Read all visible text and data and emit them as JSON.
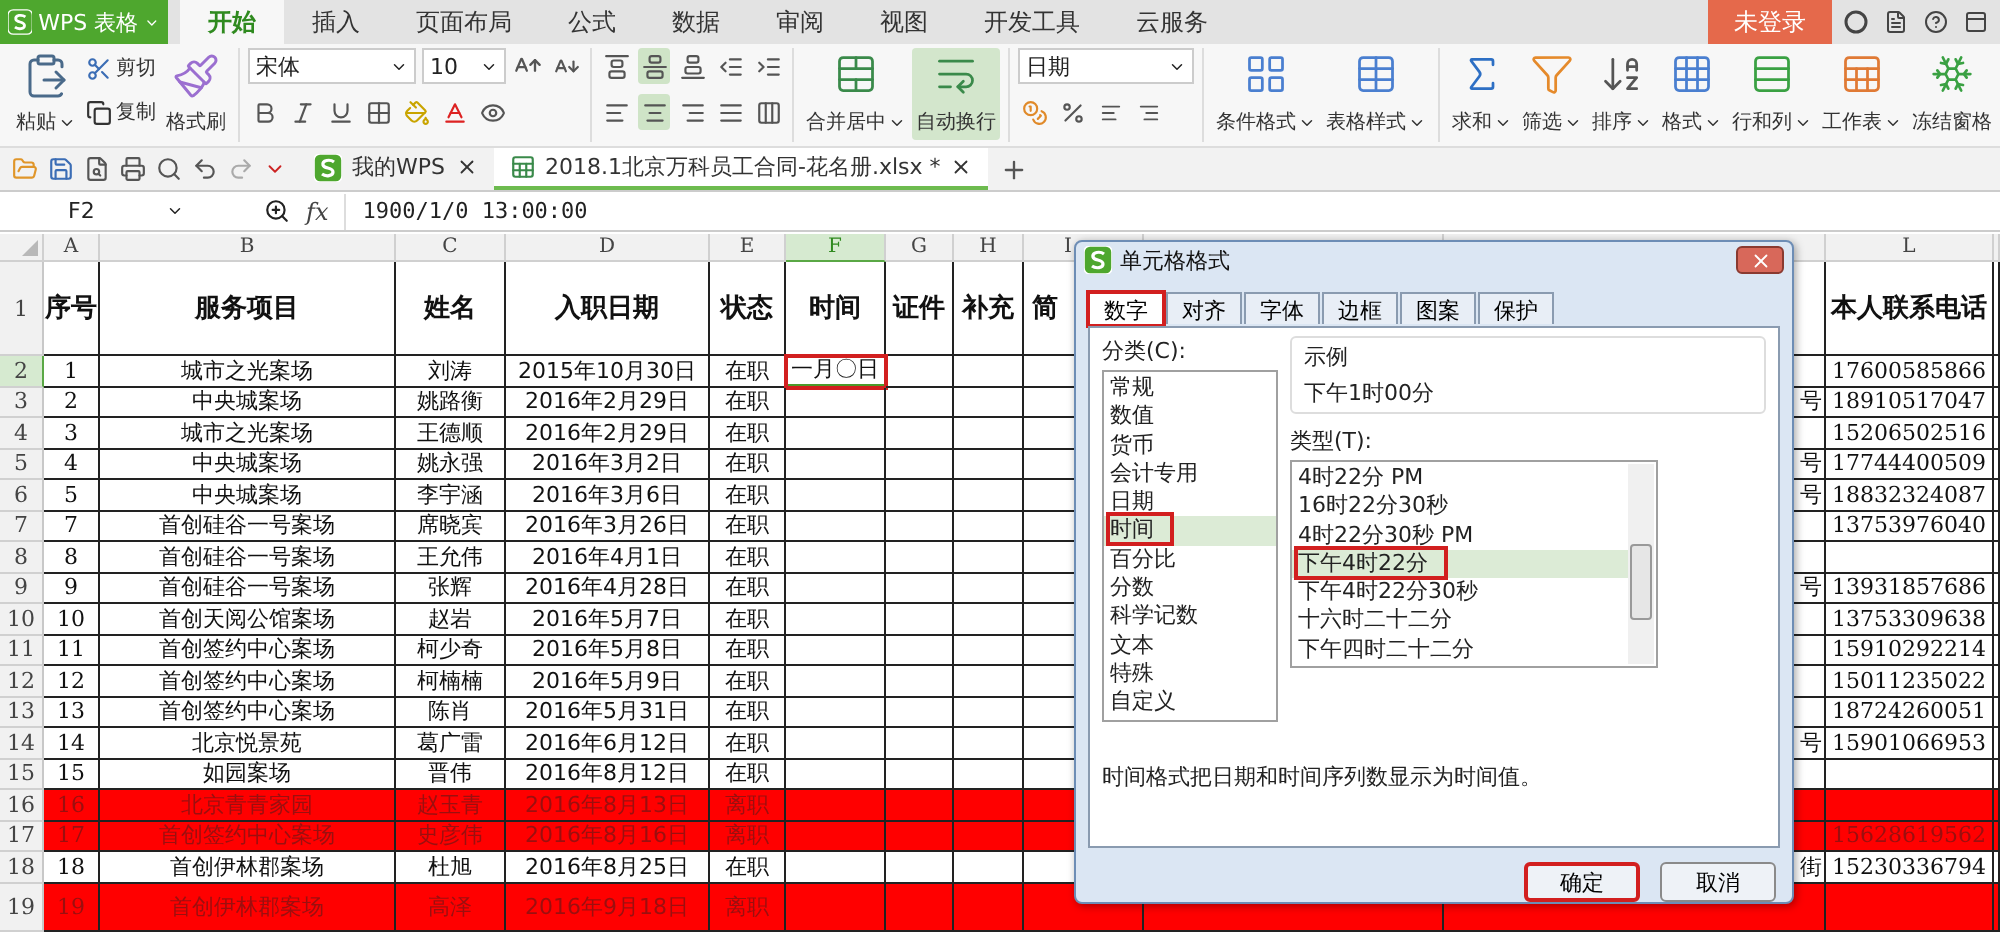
{
  "app": {
    "name": "WPS 表格"
  },
  "menu_tabs": [
    {
      "label": "开始",
      "selected": true
    },
    {
      "label": "插入",
      "selected": false
    },
    {
      "label": "页面布局",
      "selected": false
    },
    {
      "label": "公式",
      "selected": false
    },
    {
      "label": "数据",
      "selected": false
    },
    {
      "label": "审阅",
      "selected": false
    },
    {
      "label": "视图",
      "selected": false
    },
    {
      "label": "开发工具",
      "selected": false
    },
    {
      "label": "云服务",
      "selected": false
    }
  ],
  "login_button": "未登录",
  "ribbon": {
    "paste": "粘贴",
    "cut": "剪切",
    "copy": "复制",
    "format_painter": "格式刷",
    "font_name": "宋体",
    "font_size": "10",
    "alignment_buttons": [
      {
        "active": false
      },
      {
        "active": true
      },
      {
        "active": false
      },
      {
        "active": false
      },
      {
        "active": false
      },
      {
        "active": false
      },
      {
        "active": true
      },
      {
        "active": false
      },
      {
        "active": false
      },
      {
        "active": false
      }
    ],
    "cell_buttons": [
      {
        "label": "合并居中",
        "dropdown": true,
        "active": false
      },
      {
        "label": "自动换行",
        "dropdown": false,
        "active": true
      }
    ],
    "number_format": "日期",
    "style_buttons": [
      {
        "label": "条件格式",
        "dropdown": true,
        "active": false
      },
      {
        "label": "表格样式",
        "dropdown": true,
        "active": false
      }
    ],
    "edit_buttons": [
      {
        "label": "求和",
        "dropdown": true,
        "active": false
      },
      {
        "label": "筛选",
        "dropdown": true,
        "active": false
      },
      {
        "label": "排序",
        "dropdown": true,
        "active": false
      },
      {
        "label": "格式",
        "dropdown": true,
        "active": false
      },
      {
        "label": "行和列",
        "dropdown": true,
        "active": false
      },
      {
        "label": "工作表",
        "dropdown": true,
        "active": false
      },
      {
        "label": "冻结窗格",
        "dropdown": false,
        "active": false
      }
    ]
  },
  "doc_tabs": [
    {
      "label": "我的WPS",
      "selected": false
    },
    {
      "label": "2018.1北京万科员工合同-花名册.xlsx *",
      "selected": true
    }
  ],
  "formula_bar": {
    "cell": "F2",
    "function_label": "fx",
    "value": "1900/1/0 13:00:00"
  },
  "sheet": {
    "columns": [
      {
        "letter": "A",
        "selected": false
      },
      {
        "letter": "B",
        "selected": false
      },
      {
        "letter": "C",
        "selected": false
      },
      {
        "letter": "D",
        "selected": false
      },
      {
        "letter": "E",
        "selected": false
      },
      {
        "letter": "F",
        "selected": true
      },
      {
        "letter": "G",
        "selected": false
      },
      {
        "letter": "H",
        "selected": false
      },
      {
        "letter": "I",
        "selected": false
      },
      {
        "letter": "L",
        "selected": false
      }
    ],
    "header_row": {
      "row": "1",
      "cells": [
        "序号",
        "服务项目",
        "姓名",
        "入职日期",
        "状态",
        "时间",
        "证件",
        "补充",
        "简"
      ],
      "phone": "本人联系电话"
    },
    "rows": [
      {
        "row": "2",
        "cells": [
          "1",
          "城市之光案场",
          "刘涛",
          "2015年10月30日",
          "在职"
        ],
        "time": {
          "text": "一月〇日",
          "selected": true,
          "annotated": true
        },
        "phone": "17600585866",
        "highlighted": false
      },
      {
        "row": "3",
        "cells": [
          "2",
          "中央城案场",
          "姚路衡",
          "2016年2月29日",
          "在职"
        ],
        "column_k": "号",
        "phone": "18910517047",
        "highlighted": false
      },
      {
        "row": "4",
        "cells": [
          "3",
          "城市之光案场",
          "王德顺",
          "2016年2月29日",
          "在职"
        ],
        "phone": "15206502516",
        "highlighted": false
      },
      {
        "row": "5",
        "cells": [
          "4",
          "中央城案场",
          "姚永强",
          "2016年3月2日",
          "在职"
        ],
        "column_k": "号",
        "phone": "17744400509",
        "highlighted": false
      },
      {
        "row": "6",
        "cells": [
          "5",
          "中央城案场",
          "李宇涵",
          "2016年3月6日",
          "在职"
        ],
        "column_k": "号",
        "phone": "18832324087",
        "highlighted": false
      },
      {
        "row": "7",
        "cells": [
          "7",
          "首创硅谷一号案场",
          "席晓宾",
          "2016年3月26日",
          "在职"
        ],
        "phone": "13753976040",
        "highlighted": false
      },
      {
        "row": "8",
        "cells": [
          "8",
          "首创硅谷一号案场",
          "王允伟",
          "2016年4月1日",
          "在职"
        ],
        "highlighted": false
      },
      {
        "row": "9",
        "cells": [
          "9",
          "首创硅谷一号案场",
          "张辉",
          "2016年4月28日",
          "在职"
        ],
        "column_k": "号",
        "phone": "13931857686",
        "highlighted": false
      },
      {
        "row": "10",
        "cells": [
          "10",
          "首创天阅公馆案场",
          "赵岩",
          "2016年5月7日",
          "在职"
        ],
        "phone": "13753309638",
        "highlighted": false
      },
      {
        "row": "11",
        "cells": [
          "11",
          "首创签约中心案场",
          "柯少奇",
          "2016年5月8日",
          "在职"
        ],
        "phone": "15910292214",
        "highlighted": false
      },
      {
        "row": "12",
        "cells": [
          "12",
          "首创签约中心案场",
          "柯楠楠",
          "2016年5月9日",
          "在职"
        ],
        "phone": "15011235022",
        "highlighted": false
      },
      {
        "row": "13",
        "cells": [
          "13",
          "首创签约中心案场",
          "陈肖",
          "2016年5月31日",
          "在职"
        ],
        "phone": "18724260051",
        "highlighted": false
      },
      {
        "row": "14",
        "cells": [
          "14",
          "北京悦景苑",
          "葛广雷",
          "2016年6月12日",
          "在职"
        ],
        "column_k": "号",
        "phone": "15901066953",
        "highlighted": false
      },
      {
        "row": "15",
        "cells": [
          "15",
          "如园案场",
          "晋伟",
          "2016年8月12日",
          "在职"
        ],
        "highlighted": false
      },
      {
        "row": "16",
        "cells": [
          "16",
          "北京青青家园",
          "赵玉青",
          "2016年8月13日",
          "离职"
        ],
        "highlighted": true
      },
      {
        "row": "17",
        "cells": [
          "17",
          "首创签约中心案场",
          "史彦伟",
          "2016年8月16日",
          "离职"
        ],
        "phone": "15628619562",
        "highlighted": true
      },
      {
        "row": "18",
        "cells": [
          "18",
          "首创伊林郡案场",
          "杜旭",
          "2016年8月25日",
          "在职"
        ],
        "column_k": "街",
        "phone": "15230336794",
        "highlighted": false
      },
      {
        "row": "19",
        "cells": [
          "19",
          "首创伊林郡案场",
          "高泽",
          "2016年9月18日",
          "离职"
        ],
        "highlighted": true
      }
    ]
  },
  "dialog": {
    "title": "单元格格式",
    "tabs": [
      {
        "label": "数字",
        "selected": true,
        "annotated": true
      },
      {
        "label": "对齐",
        "selected": false,
        "annotated": false
      },
      {
        "label": "字体",
        "selected": false,
        "annotated": false
      },
      {
        "label": "边框",
        "selected": false,
        "annotated": false
      },
      {
        "label": "图案",
        "selected": false,
        "annotated": false
      },
      {
        "label": "保护",
        "selected": false,
        "annotated": false
      }
    ],
    "category_label": "分类(C):",
    "categories": [
      {
        "label": "常规",
        "selected": false,
        "annotated": false
      },
      {
        "label": "数值",
        "selected": false,
        "annotated": false
      },
      {
        "label": "货币",
        "selected": false,
        "annotated": false
      },
      {
        "label": "会计专用",
        "selected": false,
        "annotated": false
      },
      {
        "label": "日期",
        "selected": false,
        "annotated": false
      },
      {
        "label": "时间",
        "selected": true,
        "annotated": true
      },
      {
        "label": "百分比",
        "selected": false,
        "annotated": false
      },
      {
        "label": "分数",
        "selected": false,
        "annotated": false
      },
      {
        "label": "科学记数",
        "selected": false,
        "annotated": false
      },
      {
        "label": "文本",
        "selected": false,
        "annotated": false
      },
      {
        "label": "特殊",
        "selected": false,
        "annotated": false
      },
      {
        "label": "自定义",
        "selected": false,
        "annotated": false
      }
    ],
    "sample_label": "示例",
    "sample_value": "下午1时00分",
    "type_label": "类型(T):",
    "types": [
      {
        "label": "4时22分 PM",
        "selected": false,
        "annotated": false
      },
      {
        "label": "16时22分30秒",
        "selected": false,
        "annotated": false
      },
      {
        "label": "4时22分30秒 PM",
        "selected": false,
        "annotated": false
      },
      {
        "label": "下午4时22分",
        "selected": true,
        "annotated": true
      },
      {
        "label": "下午4时22分30秒",
        "selected": false,
        "annotated": false
      },
      {
        "label": "十六时二十二分",
        "selected": false,
        "annotated": false
      },
      {
        "label": "下午四时二十二分",
        "selected": false,
        "annotated": false
      }
    ],
    "description": "时间格式把日期和时间序列数显示为时间值。",
    "buttons": [
      {
        "label": "确定",
        "kind": "primary",
        "annotated": true
      },
      {
        "label": "取消",
        "kind": "secondary",
        "annotated": false
      }
    ]
  }
}
